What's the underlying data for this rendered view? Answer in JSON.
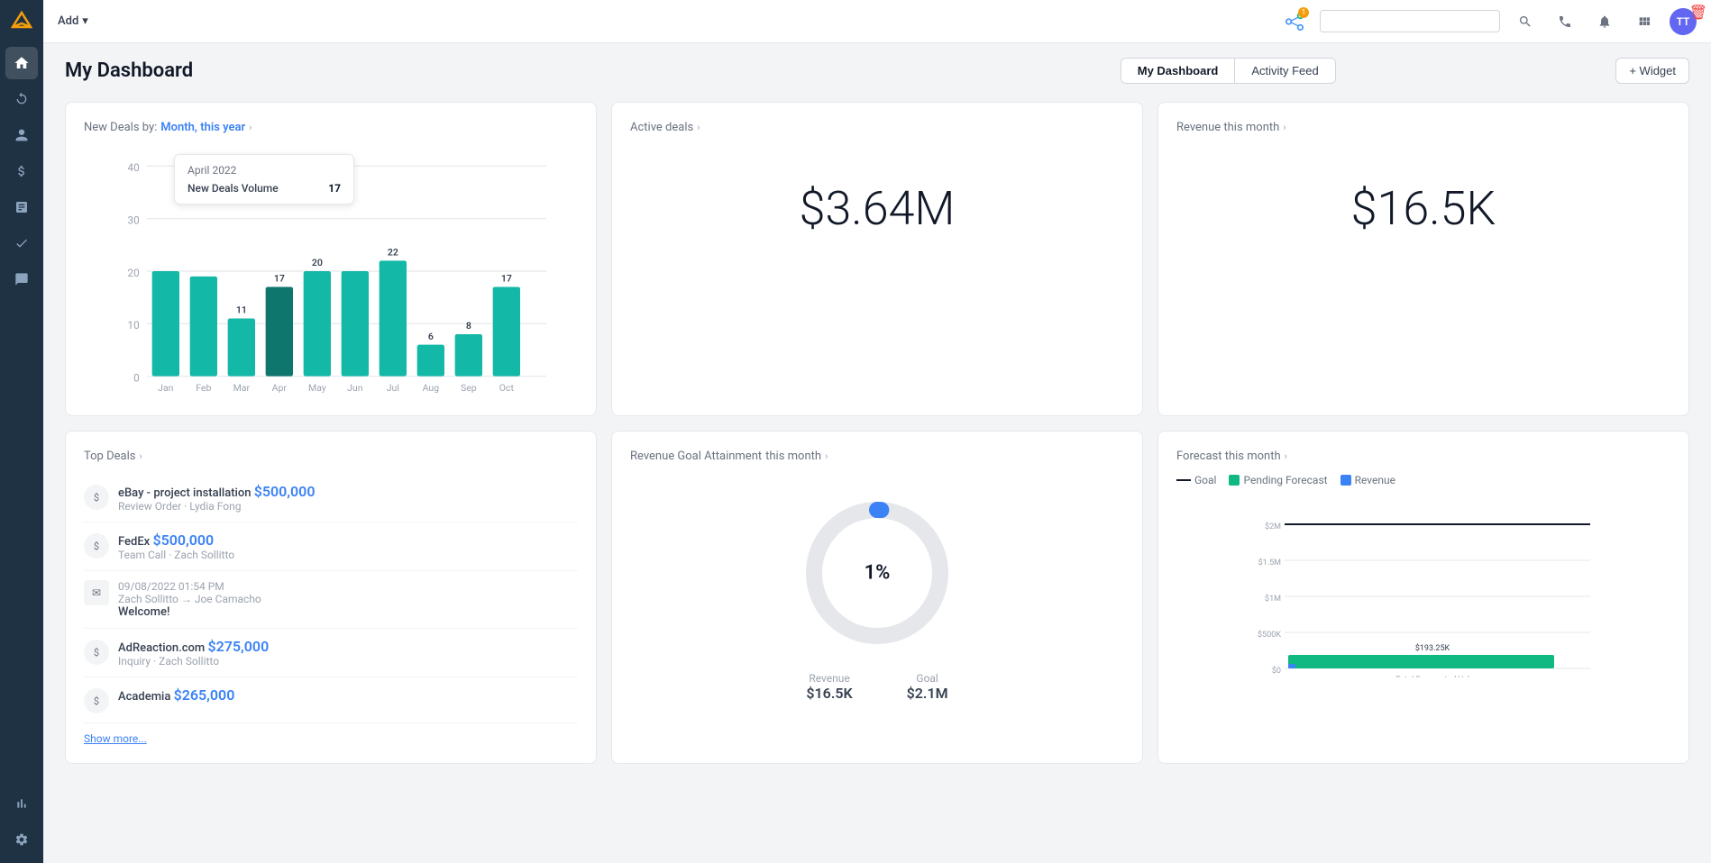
{
  "sidebar": {
    "logo": "Z",
    "items": [
      {
        "id": "home",
        "icon": "⌂",
        "active": true
      },
      {
        "id": "refresh",
        "icon": "↺"
      },
      {
        "id": "person",
        "icon": "👤"
      },
      {
        "id": "dollar",
        "icon": "$"
      },
      {
        "id": "chart",
        "icon": "📊"
      },
      {
        "id": "check",
        "icon": "✓"
      },
      {
        "id": "message",
        "icon": "💬"
      },
      {
        "id": "bar-chart",
        "icon": "📈"
      },
      {
        "id": "settings",
        "icon": "⚙"
      }
    ]
  },
  "topbar": {
    "add_label": "Add",
    "search_placeholder": "",
    "avatar_initials": "TT"
  },
  "header": {
    "title": "My Dashboard",
    "tabs": [
      {
        "id": "my-dashboard",
        "label": "My Dashboard",
        "active": true
      },
      {
        "id": "activity-feed",
        "label": "Activity Feed"
      }
    ],
    "add_widget_label": "+ Widget"
  },
  "new_deals_chart": {
    "title_prefix": "New Deals by:",
    "title_link": "Month, this year",
    "title_chevron": "›",
    "tooltip": {
      "date": "April 2022",
      "label": "New Deals Volume",
      "value": "17"
    },
    "bars": [
      {
        "month": "Jan",
        "value": 20
      },
      {
        "month": "Feb",
        "value": 19
      },
      {
        "month": "Mar",
        "value": 11
      },
      {
        "month": "Apr",
        "value": 17
      },
      {
        "month": "May",
        "value": 20
      },
      {
        "month": "Jun",
        "value": 20
      },
      {
        "month": "Jul",
        "value": 22
      },
      {
        "month": "Aug",
        "value": 6
      },
      {
        "month": "Sep",
        "value": 8
      },
      {
        "month": "Oct",
        "value": 17
      }
    ],
    "y_labels": [
      "0",
      "10",
      "20",
      "30",
      "40"
    ]
  },
  "active_deals": {
    "title": "Active deals",
    "chevron": "›",
    "value": "$3.64M"
  },
  "revenue_month": {
    "title": "Revenue this month",
    "chevron": "›",
    "value": "$16.5K"
  },
  "top_deals": {
    "title": "Top Deals",
    "chevron": "›",
    "items": [
      {
        "type": "deal",
        "name": "eBay - project installation",
        "amount": "$500,000",
        "sub": "Review Order · Lydia Fong"
      },
      {
        "type": "deal",
        "name": "FedEx",
        "amount": "$500,000",
        "sub": "Team Call · Zach Sollitto"
      },
      {
        "type": "email",
        "date": "09/08/2022 01:54 PM",
        "from": "Zach Sollitto → Joe Camacho",
        "preview": "Welcome!"
      },
      {
        "type": "deal",
        "name": "AdReaction.com",
        "amount": "$275,000",
        "sub": "Inquiry · Zach Sollitto"
      },
      {
        "type": "deal",
        "name": "Academia",
        "amount": "$265,000",
        "sub": ""
      }
    ],
    "show_more_label": "Show more..."
  },
  "revenue_goal": {
    "title": "Revenue Goal Attainment",
    "title_suffix": "this month",
    "chevron": "›",
    "percent": "1%",
    "revenue_label": "Revenue",
    "revenue_value": "$16.5K",
    "goal_label": "Goal",
    "goal_value": "$2.1M"
  },
  "forecast": {
    "title": "Forecast this month",
    "chevron": "›",
    "legend": [
      {
        "type": "line",
        "label": "Goal"
      },
      {
        "type": "green",
        "label": "Pending Forecast"
      },
      {
        "type": "blue",
        "label": "Revenue"
      }
    ],
    "y_labels": [
      "$0",
      "$500K",
      "$1M",
      "$1.5M",
      "$2M"
    ],
    "bar_label": "$193.25K",
    "x_label": "Total Forecasted Value"
  }
}
